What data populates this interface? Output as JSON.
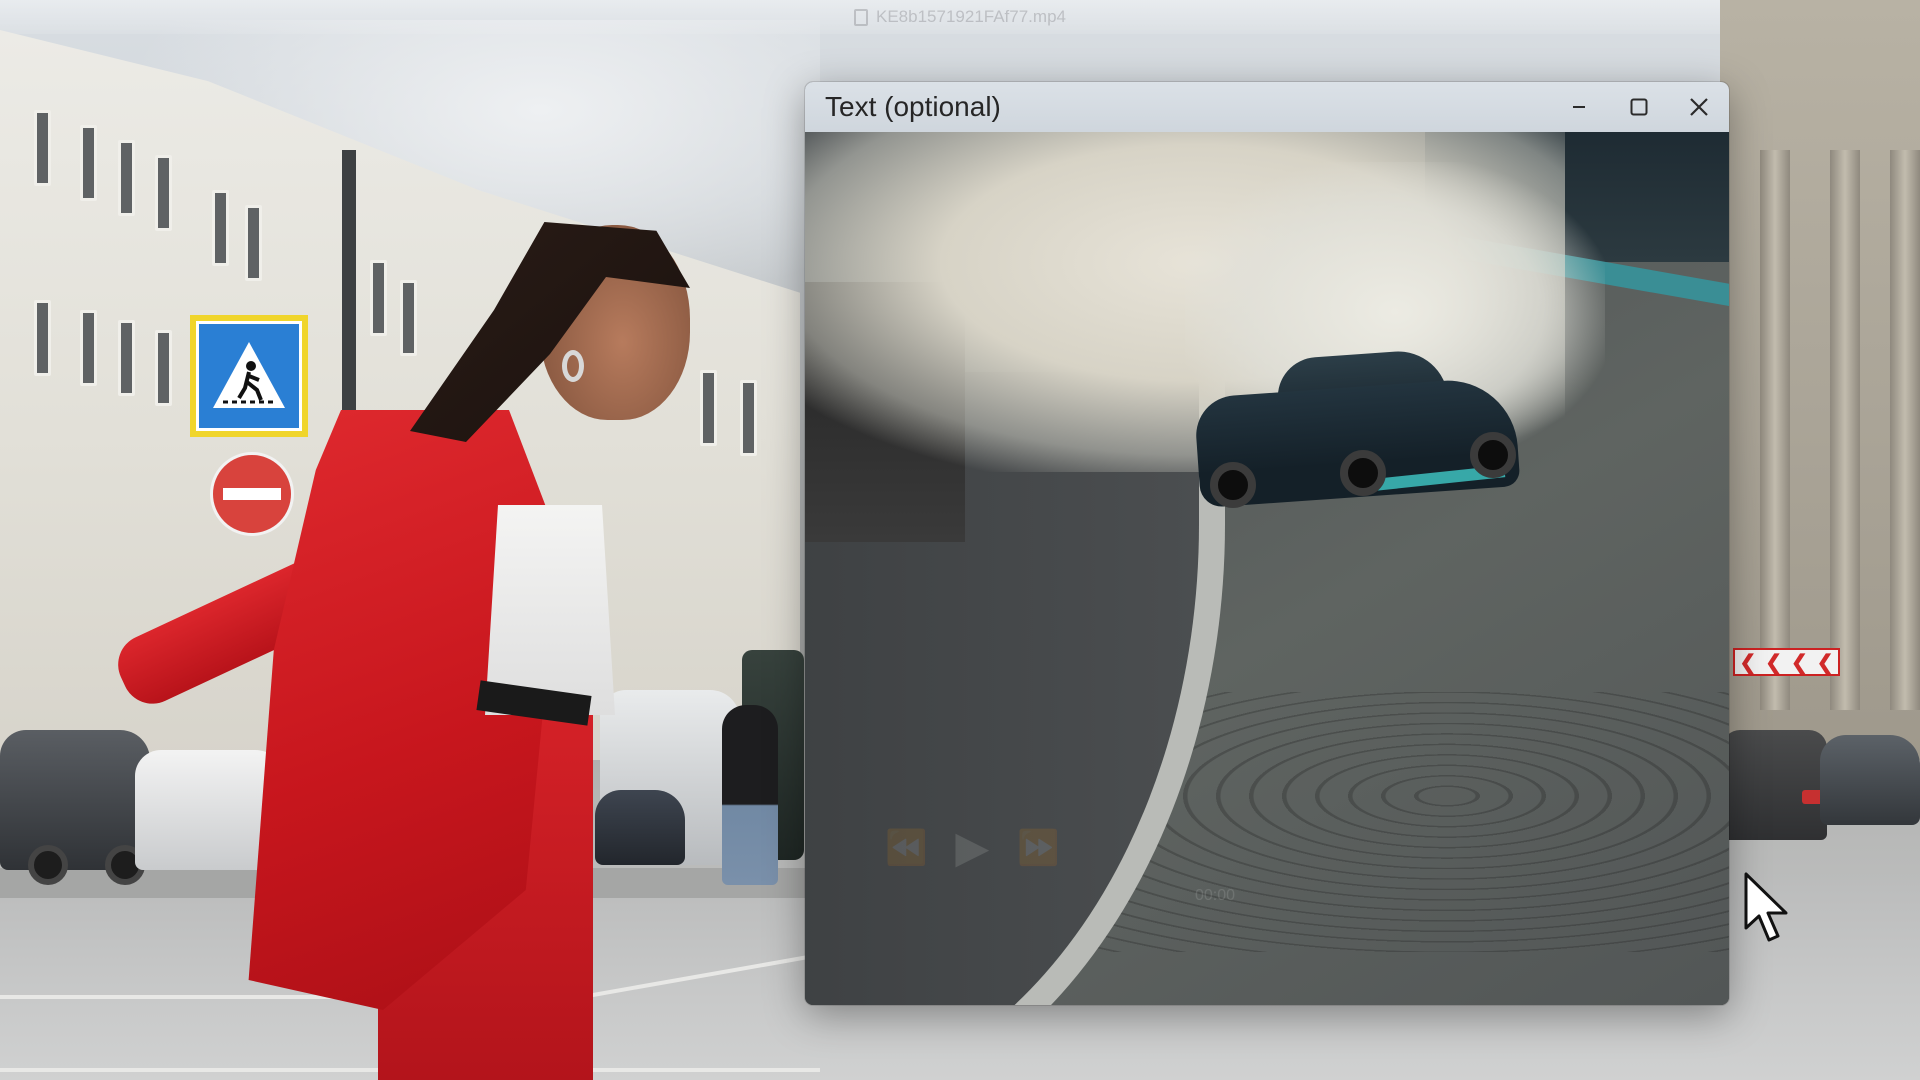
{
  "background_window": {
    "filename": "KE8b1571921FAf77.mp4"
  },
  "video_window": {
    "title": "Text (optional)",
    "controls": {
      "rewind_icon": "rewind-icon",
      "play_icon": "play-icon",
      "fast_forward_icon": "fast-forward-icon",
      "time": "00:00"
    }
  },
  "colors": {
    "titlebar_bg": "#d5dbe1",
    "jacket_red": "#d42127"
  }
}
